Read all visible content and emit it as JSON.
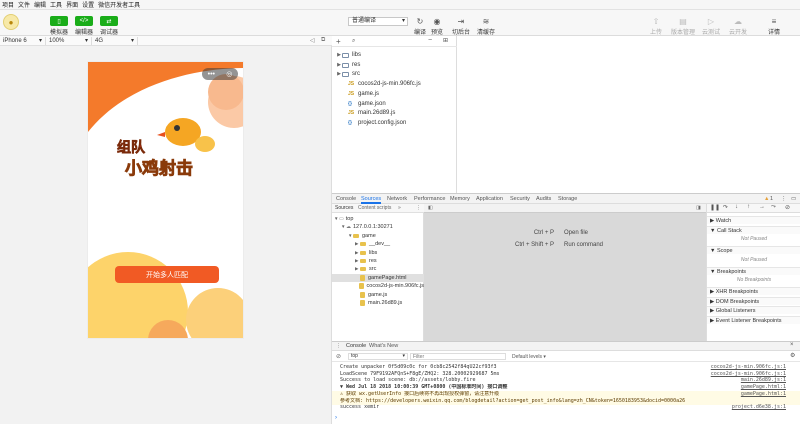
{
  "menu": [
    "项目",
    "文件",
    "编辑",
    "工具",
    "界面",
    "设置",
    "微信开发者工具"
  ],
  "toolbar": {
    "simulator_label": "模拟器",
    "editor_label": "编辑器",
    "debugger_label": "调试器",
    "compile_mode": "普通编译",
    "compile_label": "编译",
    "preview_label": "预览",
    "switch_bg_label": "切后台",
    "clear_cache_label": "清缓存",
    "upload_label": "上传",
    "version_label": "版本管理",
    "cloud_test_label": "云测试",
    "cloud_dev_label": "云开发",
    "details_label": "详情"
  },
  "simbar": {
    "device": "iPhone 6",
    "zoom": "100%",
    "network": "4G"
  },
  "game": {
    "start_button": "开始多人匹配",
    "logo_line1": "组队",
    "logo_line2": "小鸡射击"
  },
  "filetree": {
    "items": [
      {
        "name": "libs",
        "type": "folder"
      },
      {
        "name": "res",
        "type": "folder"
      },
      {
        "name": "src",
        "type": "folder"
      },
      {
        "name": "cocos2d-js-min.906fc.js",
        "type": "js"
      },
      {
        "name": "game.js",
        "type": "js"
      },
      {
        "name": "game.json",
        "type": "json"
      },
      {
        "name": "main.26d89.js",
        "type": "js"
      },
      {
        "name": "project.config.json",
        "type": "json"
      }
    ]
  },
  "devtools": {
    "tabs": [
      "Console",
      "Sources",
      "Network",
      "Performance",
      "Memory",
      "Application",
      "Security",
      "Audits",
      "Storage"
    ],
    "active_tab": "Sources",
    "warn_count": "1",
    "src_tabs": [
      "Sources",
      "Content scripts"
    ],
    "tree": [
      {
        "name": "top",
        "depth": 0,
        "kind": "frame"
      },
      {
        "name": "127.0.0.1:30271",
        "depth": 1,
        "kind": "cloud"
      },
      {
        "name": "game",
        "depth": 2,
        "kind": "folder"
      },
      {
        "name": "__dev__",
        "depth": 3,
        "kind": "folder"
      },
      {
        "name": "libs",
        "depth": 3,
        "kind": "folder"
      },
      {
        "name": "res",
        "depth": 3,
        "kind": "folder"
      },
      {
        "name": "src",
        "depth": 3,
        "kind": "folder"
      },
      {
        "name": "gamePage.html",
        "depth": 3,
        "kind": "file"
      },
      {
        "name": "cocos2d-js-min.906fc.js",
        "depth": 3,
        "kind": "file"
      },
      {
        "name": "game.js",
        "depth": 3,
        "kind": "file"
      },
      {
        "name": "main.26d89.js",
        "depth": 3,
        "kind": "file"
      }
    ],
    "shortcuts": [
      {
        "keys": "Ctrl + P",
        "action": "Open file"
      },
      {
        "keys": "Ctrl + Shift + P",
        "action": "Run command"
      }
    ],
    "right_sections": [
      {
        "title": "Watch",
        "note": ""
      },
      {
        "title": "Call Stack",
        "note": "Not Paused"
      },
      {
        "title": "Scope",
        "note": "Not Paused"
      },
      {
        "title": "Breakpoints",
        "note": "No Breakpoints"
      },
      {
        "title": "XHR Breakpoints",
        "note": ""
      },
      {
        "title": "DOM Breakpoints",
        "note": ""
      },
      {
        "title": "Global Listeners",
        "note": ""
      },
      {
        "title": "Event Listener Breakpoints",
        "note": ""
      }
    ]
  },
  "console": {
    "tabs": [
      "Console",
      "What's New"
    ],
    "context": "top",
    "filter_placeholder": "Filter",
    "levels": "Default levels",
    "lines": [
      {
        "text": "Create unpacker 0f5d09c0c for 0cb8c2542f84qU22cf93f3",
        "src": "cocos2d-js-min.906fc.js:1",
        "kind": "log"
      },
      {
        "text": "LoadScene 79F9192AFQnS+F8gE/ZHQ2: 328.20002929687 5ms",
        "src": "cocos2d-js-min.906fc.js:1",
        "kind": "log"
      },
      {
        "text": "Success to load scene: db://assets/lobby.fire",
        "src": "main.26d89.js:1",
        "kind": "log"
      },
      {
        "text": "▼ Wed Jul 18 2018 10:00:39 GMT+0800 (中国标准时间) 接口调整",
        "src": "gamePage.html:1",
        "kind": "group"
      },
      {
        "text": "⚠ 获取 wx.getUserInfo 接口后续将不再出现授权弹窗，请注意升级",
        "src": "gamePage.html:1",
        "kind": "warn"
      },
      {
        "text": "参考文档: https://developers.weixin.qq.com/blogdetail?action=get_post_info&lang=zh_CN&token=1650183953&docid=0000a26",
        "src": "",
        "kind": "warn"
      },
      {
        "text": "success xemir",
        "src": "project.d6e38.js:1",
        "kind": "log"
      }
    ]
  }
}
